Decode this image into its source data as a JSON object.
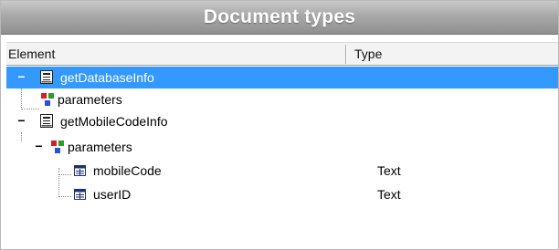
{
  "title": "Document types",
  "columns": {
    "element": "Element",
    "type": "Type"
  },
  "tree": {
    "nodes": [
      {
        "label": "getDatabaseInfo",
        "expander": "−",
        "selected": true,
        "children": [
          {
            "label": "parameters"
          }
        ]
      },
      {
        "label": "getMobileCodeInfo",
        "expander": "−",
        "selected": false,
        "children": [
          {
            "label": "parameters",
            "expander": "−",
            "children": [
              {
                "label": "mobileCode",
                "type": "Text"
              },
              {
                "label": "userID",
                "type": "Text"
              }
            ]
          }
        ]
      }
    ]
  },
  "colors": {
    "selection": "#3399ff",
    "title_bar": "#a9a9a9"
  }
}
